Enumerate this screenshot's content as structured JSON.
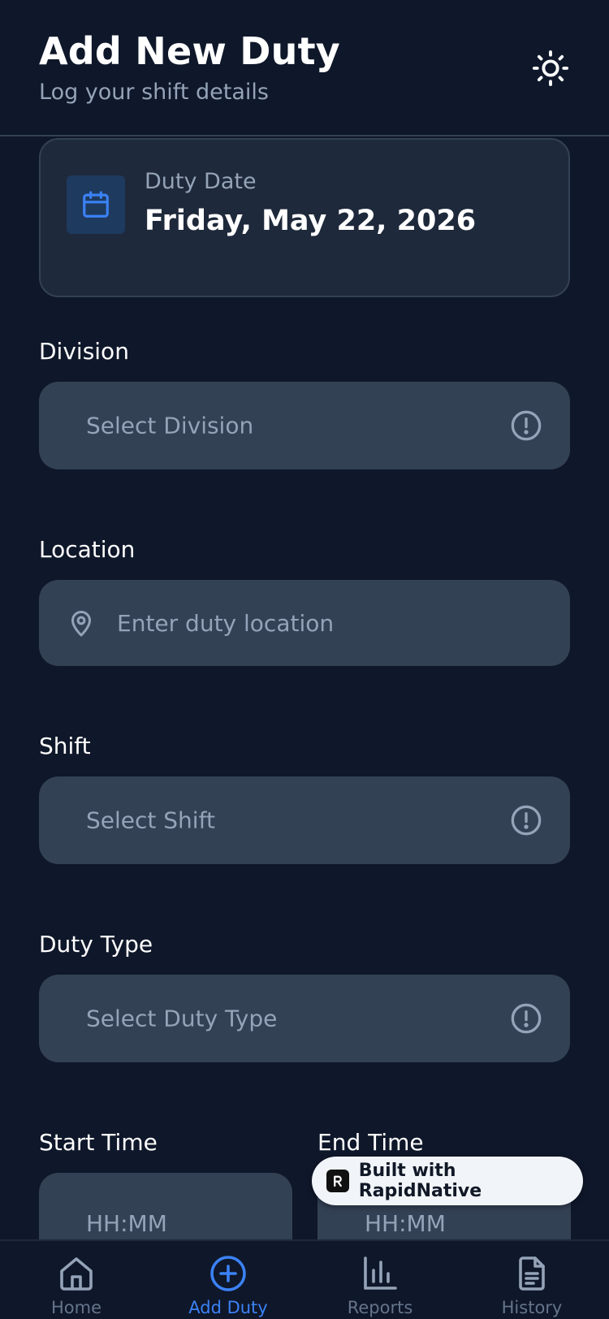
{
  "header": {
    "title": "Add New Duty",
    "subtitle": "Log your shift details",
    "theme_toggle_icon": "sun-icon"
  },
  "date_card": {
    "label": "Duty Date",
    "value": "Friday, May 22, 2026",
    "icon": "calendar-icon"
  },
  "fields": {
    "division": {
      "label": "Division",
      "placeholder": "Select Division"
    },
    "location": {
      "label": "Location",
      "placeholder": "Enter duty location"
    },
    "shift": {
      "label": "Shift",
      "placeholder": "Select Shift"
    },
    "duty_type": {
      "label": "Duty Type",
      "placeholder": "Select Duty Type"
    },
    "start_time": {
      "label": "Start Time",
      "placeholder": "HH:MM"
    },
    "end_time": {
      "label": "End Time",
      "placeholder": "HH:MM"
    }
  },
  "badge": {
    "text": "Built with RapidNative"
  },
  "nav": {
    "items": [
      {
        "label": "Home",
        "icon": "home-icon",
        "active": false
      },
      {
        "label": "Add Duty",
        "icon": "plus-circle-icon",
        "active": true
      },
      {
        "label": "Reports",
        "icon": "bar-chart-icon",
        "active": false
      },
      {
        "label": "History",
        "icon": "document-icon",
        "active": false
      }
    ]
  },
  "colors": {
    "background": "#0f172a",
    "card": "#1e293b",
    "input": "#334155",
    "accent": "#3b82f6",
    "muted_text": "#94a3b8"
  }
}
